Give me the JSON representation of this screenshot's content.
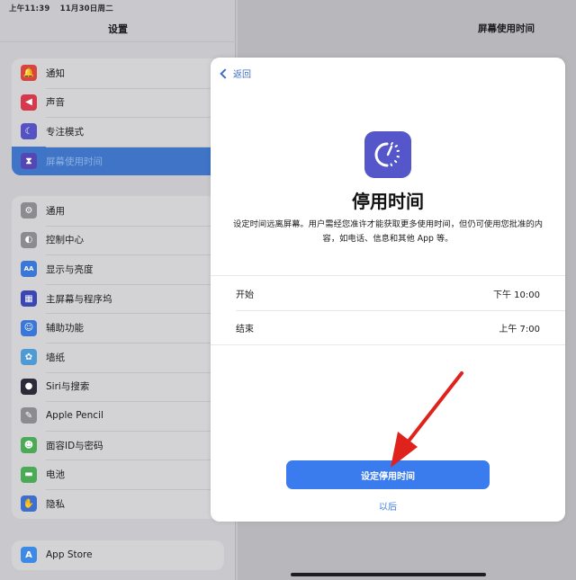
{
  "status_bar": {
    "time": "上午11:39",
    "date": "11月30日周二"
  },
  "sidebar": {
    "title": "设置",
    "groups": [
      {
        "items": [
          {
            "label": "通知",
            "icon": "bell-icon",
            "color": "#d8453e",
            "glyph": "🔔"
          },
          {
            "label": "声音",
            "icon": "speaker-icon",
            "color": "#d6394c",
            "glyph": "◀"
          },
          {
            "label": "专注模式",
            "icon": "moon-icon",
            "color": "#5552c4",
            "glyph": "☾"
          },
          {
            "label": "屏幕使用时间",
            "icon": "hourglass-icon",
            "color": "#5447b5",
            "glyph": "⧗",
            "selected": true
          }
        ]
      },
      {
        "items": [
          {
            "label": "通用",
            "icon": "gear-icon",
            "color": "#8c8c90",
            "glyph": "⚙"
          },
          {
            "label": "控制中心",
            "icon": "toggles-icon",
            "color": "#8c8c90",
            "glyph": "◐"
          },
          {
            "label": "显示与亮度",
            "icon": "text-size-icon",
            "color": "#3b77d6",
            "glyph": "AA"
          },
          {
            "label": "主屏幕与程序坞",
            "icon": "home-grid-icon",
            "color": "#3a47b3",
            "glyph": "▦"
          },
          {
            "label": "辅助功能",
            "icon": "accessibility-icon",
            "color": "#3b77d6",
            "glyph": "☺"
          },
          {
            "label": "墙纸",
            "icon": "flower-icon",
            "color": "#4e9ad4",
            "glyph": "✿"
          },
          {
            "label": "Siri与搜索",
            "icon": "siri-icon",
            "color": "#2b2b3a",
            "glyph": "●"
          },
          {
            "label": "Apple Pencil",
            "icon": "pencil-icon",
            "color": "#8c8c90",
            "glyph": "✎"
          },
          {
            "label": "面容ID与密码",
            "icon": "face-id-icon",
            "color": "#4aaa55",
            "glyph": "☻"
          },
          {
            "label": "电池",
            "icon": "battery-icon",
            "color": "#4aaa55",
            "glyph": "▬"
          },
          {
            "label": "隐私",
            "icon": "hand-icon",
            "color": "#3b6fd0",
            "glyph": "✋"
          }
        ]
      },
      {
        "items": [
          {
            "label": "App Store",
            "icon": "app-store-icon",
            "color": "#3d8ae6",
            "glyph": "A"
          }
        ]
      }
    ]
  },
  "detail": {
    "title": "屏幕使用时间"
  },
  "modal": {
    "back_label": "返回",
    "title": "停用时间",
    "description": "设定时间远离屏幕。用户需经您准许才能获取更多使用时间，但仍可使用您批准的内容，如电话、信息和其他 App 等。",
    "rows": [
      {
        "label": "开始",
        "value": "下午 10:00"
      },
      {
        "label": "结束",
        "value": "上午 7:00"
      }
    ],
    "primary_button": "设定停用时间",
    "secondary_button": "以后",
    "accent_color": "#3a7bed",
    "icon_color": "#5456c9"
  },
  "annotation": {
    "type": "red-arrow",
    "color": "#e0221c",
    "points_to": "设定停用时间"
  }
}
